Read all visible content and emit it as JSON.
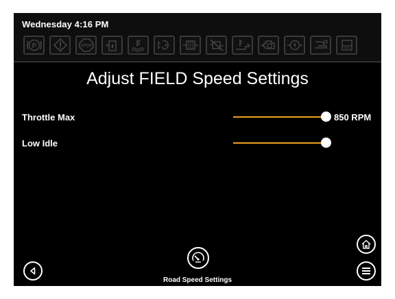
{
  "header": {
    "clock": "Wednesday 4:16 PM",
    "telltales": [
      "parking-brake-icon",
      "warning-icon",
      "stop-icon",
      "water-in-fuel-icon",
      "coolant-level-icon",
      "regen-icon",
      "dpf-icon",
      "regen-inhibit-icon",
      "exhaust-temp-icon",
      "engine-icon",
      "oil-pressure-icon",
      "coolant-temp-icon",
      "def-level-icon"
    ]
  },
  "page": {
    "title": "Adjust FIELD Speed Settings"
  },
  "settings": [
    {
      "label": "Throttle Max",
      "value_text": "850 RPM",
      "level": 1.0
    },
    {
      "label": "Low Idle",
      "value_text": "",
      "level": 1.0
    }
  ],
  "footer": {
    "road_speed_label": "Road Speed Settings"
  },
  "colors": {
    "accent": "#f0a020",
    "background": "#000000",
    "text": "#ffffff"
  }
}
